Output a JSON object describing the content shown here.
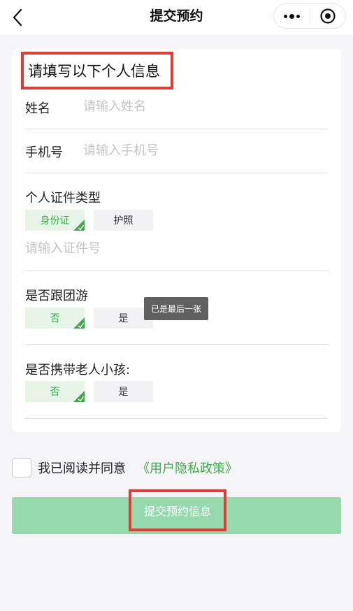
{
  "header": {
    "title": "提交预约",
    "back_icon": "chevron-left-icon",
    "more_icon": "more-dots-icon",
    "close_icon": "target-circle-icon"
  },
  "form": {
    "heading": "请填写以下个人信息",
    "name": {
      "label": "姓名",
      "placeholder": "请输入姓名",
      "value": ""
    },
    "phone": {
      "label": "手机号",
      "placeholder": "请输入手机号",
      "value": ""
    },
    "id_type": {
      "label": "个人证件类型",
      "options": [
        {
          "label": "身份证",
          "selected": true
        },
        {
          "label": "护照",
          "selected": false
        }
      ],
      "id_placeholder": "请输入证件号"
    },
    "group_tour": {
      "label": "是否跟团游",
      "options": [
        {
          "label": "否",
          "selected": true
        },
        {
          "label": "是",
          "selected": false
        }
      ]
    },
    "with_elderly_kids": {
      "label": "是否携带老人小孩:",
      "options": [
        {
          "label": "否",
          "selected": true
        },
        {
          "label": "是",
          "selected": false
        }
      ]
    }
  },
  "toast": {
    "text": "已是最后一张"
  },
  "agreement": {
    "checked": false,
    "text": "我已阅读并同意",
    "link": "《用户隐私政策》"
  },
  "submit": {
    "label": "提交预约信息"
  },
  "colors": {
    "accent": "#3ea94b",
    "selected_bg": "#e6f5e8",
    "submit_bg": "#95d9ac",
    "highlight": "#e53935"
  }
}
